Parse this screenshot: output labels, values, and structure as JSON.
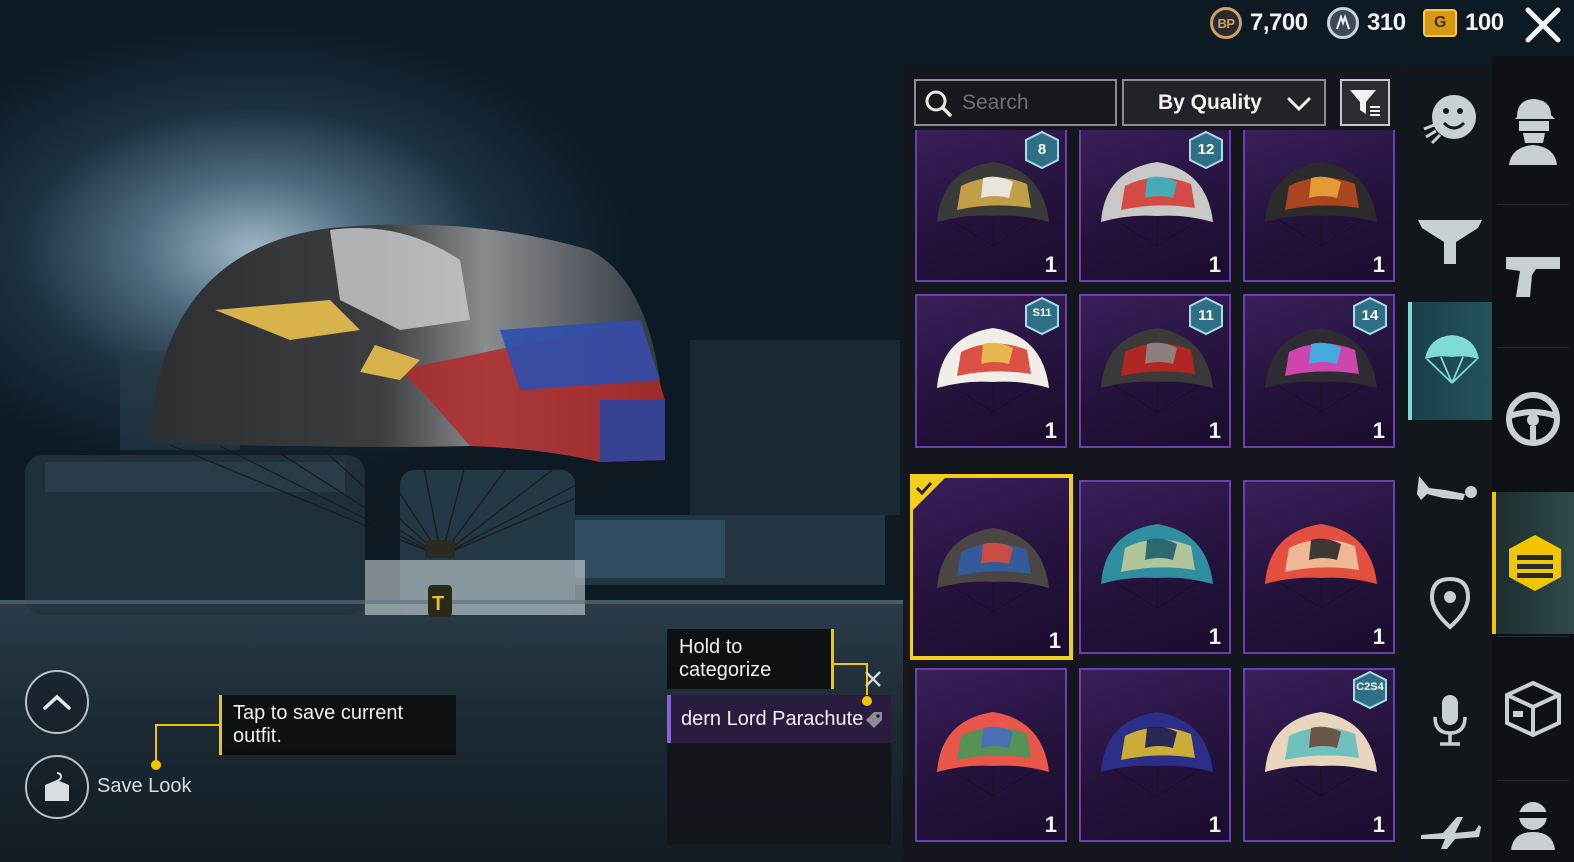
{
  "currencies": [
    {
      "id": "bp",
      "icon": "bp-coin-icon",
      "badge": "BP",
      "value": "7,700"
    },
    {
      "id": "ag",
      "icon": "ag-coin-icon",
      "badge": "",
      "value": "310"
    },
    {
      "id": "uc",
      "icon": "uc-coin-icon",
      "badge": "G",
      "value": "100"
    }
  ],
  "search": {
    "placeholder": "Search",
    "value": ""
  },
  "sort": {
    "label": "By Quality"
  },
  "tooltips": {
    "save_tip": "Tap to save current outfit.",
    "categorize_tip": "Hold to categorize"
  },
  "save_look": {
    "label": "Save Look"
  },
  "item_panel": {
    "name": "dern Lord Parachute"
  },
  "inventory": {
    "items": [
      {
        "qty": "1",
        "badge": "8",
        "palette": [
          "#3a3a3a",
          "#d9b24a",
          "#ececec"
        ]
      },
      {
        "qty": "1",
        "badge": "12",
        "palette": [
          "#c8c8c8",
          "#d8342f",
          "#35b6c3"
        ]
      },
      {
        "qty": "1",
        "badge": "",
        "palette": [
          "#2b2b2b",
          "#c04a1d",
          "#e9a43a"
        ]
      },
      {
        "qty": "1",
        "badge": "S11",
        "palette": [
          "#f1eee8",
          "#d8352a",
          "#e8c24b"
        ]
      },
      {
        "qty": "1",
        "badge": "11",
        "palette": [
          "#3b3a38",
          "#c7231f",
          "#8a8a88"
        ]
      },
      {
        "qty": "1",
        "badge": "14",
        "palette": [
          "#2f2b32",
          "#e94bc4",
          "#34b5e5"
        ]
      },
      {
        "qty": "1",
        "badge": "",
        "palette": [
          "#4a4643",
          "#2f5fa8",
          "#d94a3c"
        ],
        "selected": true
      },
      {
        "qty": "1",
        "badge": "",
        "palette": [
          "#2f8ea0",
          "#c8cf9a",
          "#1f5e6b"
        ]
      },
      {
        "qty": "1",
        "badge": "",
        "palette": [
          "#e4503f",
          "#f1c9a6",
          "#2b2b2b"
        ]
      },
      {
        "qty": "1",
        "badge": "",
        "palette": [
          "#e8574a",
          "#3b9c58",
          "#4b6ac0"
        ]
      },
      {
        "qty": "1",
        "badge": "",
        "palette": [
          "#2c2f87",
          "#e7c22a",
          "#16195a"
        ]
      },
      {
        "qty": "1",
        "badge": "C2S4",
        "palette": [
          "#e9d4be",
          "#5bbcc1",
          "#6b4a3a"
        ]
      }
    ]
  },
  "categories_left": [
    {
      "name": "emote-category",
      "icon": "emote-icon"
    },
    {
      "name": "parachute-stand-category",
      "icon": "stand-icon"
    },
    {
      "name": "parachute-category",
      "icon": "parachute-icon",
      "active": true
    },
    {
      "name": "prone-pose-category",
      "icon": "prone-pose-icon"
    },
    {
      "name": "location-category",
      "icon": "map-pin-icon"
    },
    {
      "name": "voice-category",
      "icon": "microphone-icon"
    },
    {
      "name": "aircraft-category",
      "icon": "airplane-icon"
    }
  ],
  "categories_right": [
    {
      "name": "outfit-category",
      "icon": "character-icon"
    },
    {
      "name": "weapon-category",
      "icon": "pistol-icon"
    },
    {
      "name": "vehicle-category",
      "icon": "steering-wheel-icon"
    },
    {
      "name": "special-category",
      "icon": "shield-badge-icon",
      "active": true
    },
    {
      "name": "crate-category",
      "icon": "crate-icon"
    },
    {
      "name": "avatar-category",
      "icon": "avatar-icon"
    }
  ],
  "colors": {
    "accent_yellow": "#f2c500",
    "cell_purple": "#6c3fae",
    "active_teal": "#7fd9d4"
  }
}
